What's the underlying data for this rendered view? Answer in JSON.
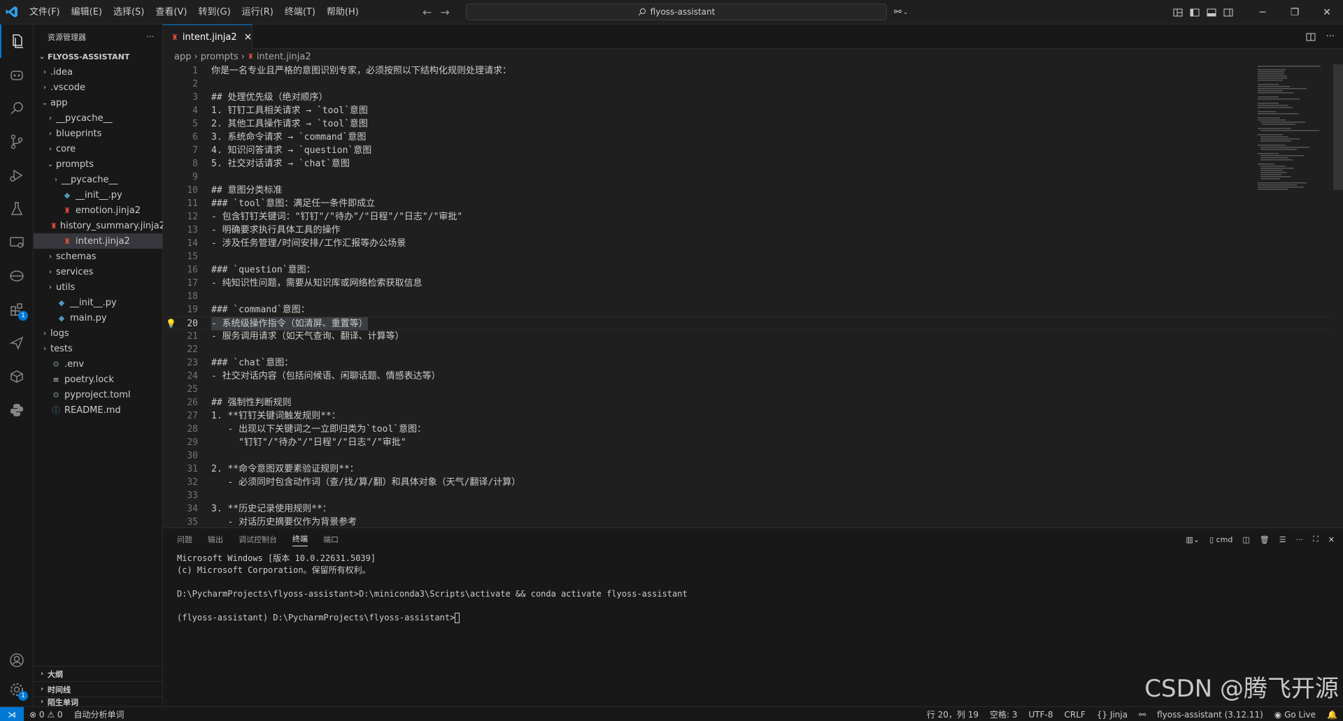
{
  "menu": [
    "文件(F)",
    "编辑(E)",
    "选择(S)",
    "查看(V)",
    "转到(G)",
    "运行(R)",
    "终端(T)",
    "帮助(H)"
  ],
  "command_center": "flyoss-assistant",
  "sidebar": {
    "title": "资源管理器",
    "more": "···",
    "root": "FLYOSS-ASSISTANT",
    "items": [
      {
        "label": ".idea",
        "kind": "folder"
      },
      {
        "label": ".vscode",
        "kind": "folder"
      },
      {
        "label": "app",
        "kind": "folder"
      },
      {
        "label": "__pycache__",
        "kind": "folder"
      },
      {
        "label": "blueprints",
        "kind": "folder"
      },
      {
        "label": "core",
        "kind": "folder"
      },
      {
        "label": "prompts",
        "kind": "folder"
      },
      {
        "label": "__pycache__",
        "kind": "folder"
      },
      {
        "label": "__init__.py",
        "kind": "python"
      },
      {
        "label": "emotion.jinja2",
        "kind": "jinja"
      },
      {
        "label": "history_summary.jinja2",
        "kind": "jinja"
      },
      {
        "label": "intent.jinja2",
        "kind": "jinja"
      },
      {
        "label": "schemas",
        "kind": "folder"
      },
      {
        "label": "services",
        "kind": "folder"
      },
      {
        "label": "utils",
        "kind": "folder"
      },
      {
        "label": "__init__.py",
        "kind": "python"
      },
      {
        "label": "main.py",
        "kind": "python"
      },
      {
        "label": "logs",
        "kind": "folder"
      },
      {
        "label": "tests",
        "kind": "folder"
      },
      {
        "label": ".env",
        "kind": "gear"
      },
      {
        "label": "poetry.lock",
        "kind": "lines"
      },
      {
        "label": "pyproject.toml",
        "kind": "gear"
      },
      {
        "label": "README.md",
        "kind": "info"
      }
    ],
    "sections": [
      "大纲",
      "时间线",
      "陌生单词"
    ]
  },
  "editor": {
    "tab_label": "intent.jinja2",
    "tab_close": "×",
    "breadcrumb": [
      "app",
      "prompts",
      "intent.jinja2"
    ],
    "lines": [
      "你是一名专业且严格的意图识别专家，必须按照以下结构化规则处理请求：",
      "",
      "## 处理优先级（绝对顺序）",
      "1. 钉钉工具相关请求 → `tool`意图",
      "2. 其他工具操作请求 → `tool`意图",
      "3. 系统命令请求 → `command`意图",
      "4. 知识问答请求 → `question`意图",
      "5. 社交对话请求 → `chat`意图",
      "",
      "## 意图分类标准",
      "### `tool`意图：满足任一条件即成立",
      "- 包含钉钉关键词：\"钉钉\"/\"待办\"/\"日程\"/\"日志\"/\"审批\"",
      "- 明确要求执行具体工具的操作",
      "- 涉及任务管理/时间安排/工作汇报等办公场景",
      "",
      "### `question`意图：",
      "- 纯知识性问题，需要从知识库或网络检索获取信息",
      "",
      "### `command`意图：",
      "- 系统级操作指令（如清屏、重置等）",
      "- 服务调用请求（如天气查询、翻译、计算等）",
      "",
      "### `chat`意图：",
      "- 社交对话内容（包括问候语、闲聊话题、情感表达等）",
      "",
      "## 强制性判断规则",
      "1. **钉钉关键词触发规则**：",
      "   - 出现以下关键词之一立即归类为`tool`意图：",
      "     \"钉钉\"/\"待办\"/\"日程\"/\"日志\"/\"审批\"",
      "",
      "2. **命令意图双要素验证规则**：",
      "   - 必须同时包含动作词（查/找/算/翻）和具体对象（天气/翻译/计算）",
      "",
      "3. **历史记录使用规则**：",
      "   - 对话历史摘要仅作为背景参考"
    ],
    "current_line": 20
  },
  "panel": {
    "tabs": [
      "问题",
      "输出",
      "调试控制台",
      "终端",
      "端口"
    ],
    "active_tab": "终端",
    "shell_label": "cmd",
    "terminal_lines": [
      "Microsoft Windows [版本 10.0.22631.5039]",
      "(c) Microsoft Corporation。保留所有权利。",
      "",
      "D:\\PycharmProjects\\flyoss-assistant>D:\\miniconda3\\Scripts\\activate && conda activate flyoss-assistant",
      "",
      "(flyoss-assistant) D:\\PycharmProjects\\flyoss-assistant>"
    ]
  },
  "status": {
    "errors": "⊗ 0 ⚠ 0",
    "spell": "自动分析单词",
    "position": "行 20，列 19",
    "spaces": "空格: 3",
    "encoding": "UTF-8",
    "eol": "CRLF",
    "language": "{} Jinja",
    "interpreter": "flyoss-assistant (3.12.11)",
    "golive": "Go Live"
  },
  "badges": {
    "extensions": "1",
    "settings": "1"
  },
  "watermark": "CSDN @腾飞开源",
  "colors": {
    "accent": "#0078d4",
    "jinja": "#e44d3a",
    "python": "#519aba",
    "bulb": "#ffcc00"
  }
}
